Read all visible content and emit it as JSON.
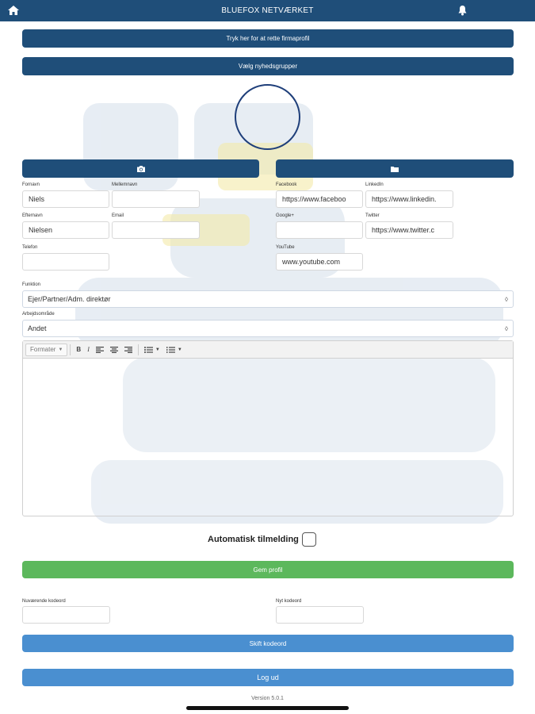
{
  "app": {
    "title": "BLUEFOX NETVÆRKET",
    "home_icon": "home-icon",
    "notification_icon": "bell-icon"
  },
  "actions": {
    "company_profile_label": "Tryk her for at rette firmaprofil",
    "newsgroups_label": "Vælg nyhedsgrupper",
    "camera_icon": "camera-icon",
    "folder_icon": "folder-icon"
  },
  "profile": {
    "fornavn": {
      "label": "Fornavn",
      "value": "Niels"
    },
    "mellemnavn": {
      "label": "Mellemnavn",
      "value": ""
    },
    "efternavn": {
      "label": "Efternavn",
      "value": "Nielsen"
    },
    "email": {
      "label": "Email",
      "value": ""
    },
    "telefon": {
      "label": "Telefon",
      "value": ""
    },
    "facebook": {
      "label": "Facebook",
      "value": "https://www.faceboo"
    },
    "linkedin": {
      "label": "LinkedIn",
      "value": "https://www.linkedin."
    },
    "googleplus": {
      "label": "Google+",
      "value": ""
    },
    "twitter": {
      "label": "Twitter",
      "value": "https://www.twitter.c"
    },
    "youtube": {
      "label": "YouTube",
      "value": "www.youtube.com"
    }
  },
  "funktion": {
    "label": "Funktion",
    "value": "Ejer/Partner/Adm. direktør"
  },
  "arbejdsomraade": {
    "label": "Arbejdsområde",
    "value": "Andet"
  },
  "editor": {
    "format_label": "Formater",
    "bold_label": "B",
    "italic_label": "I"
  },
  "auto_signup": {
    "label": "Automatisk tilmelding",
    "checked": false
  },
  "save_label": "Gem profil",
  "password": {
    "current_label": "Nuværende kodeord",
    "new_label": "Nyt kodeord",
    "change_label": "Skift kodeord"
  },
  "logout_label": "Log ud",
  "version": "Version 5.0.1",
  "colors": {
    "primary": "#1f4e79",
    "success": "#5cb85c",
    "info": "#4a8fd0"
  }
}
